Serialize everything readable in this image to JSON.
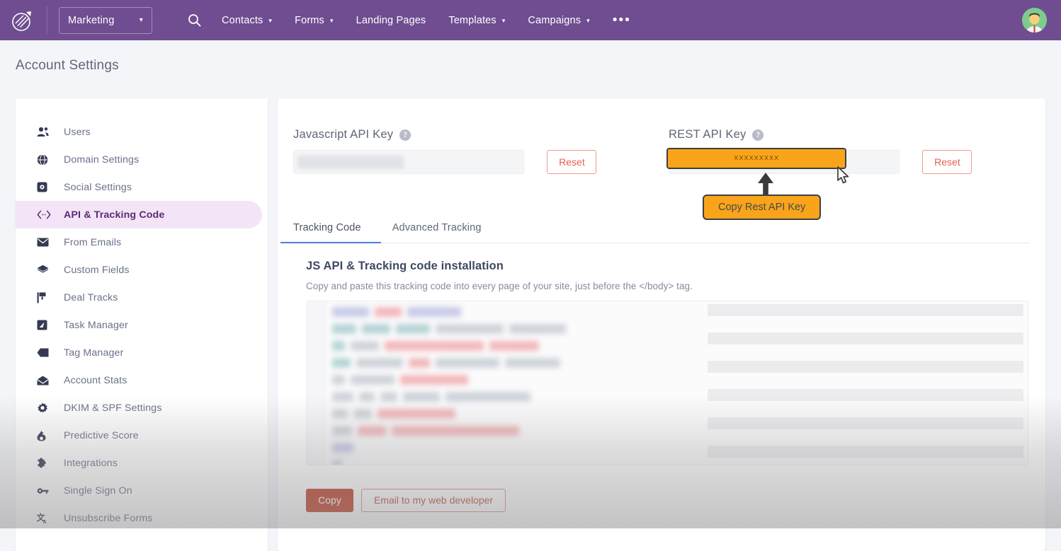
{
  "topnav": {
    "logo_icon": "agile-logo-icon",
    "org_selector": {
      "label": "Marketing",
      "caret": "▾"
    },
    "search_icon": "search-icon",
    "items": [
      {
        "label": "Contacts",
        "has_caret": true
      },
      {
        "label": "Forms",
        "has_caret": true
      },
      {
        "label": "Landing Pages",
        "has_caret": false
      },
      {
        "label": "Templates",
        "has_caret": true
      },
      {
        "label": "Campaigns",
        "has_caret": true
      }
    ],
    "more_label": "•••",
    "avatar_icon": "user-avatar-icon",
    "background_color": "#6f4d90"
  },
  "page": {
    "title": "Account Settings",
    "background_color": "#f4f5f9"
  },
  "sidebar": {
    "items": [
      {
        "label": "Users",
        "icon": "users-icon",
        "active": false
      },
      {
        "label": "Domain Settings",
        "icon": "globe-icon",
        "active": false
      },
      {
        "label": "Social Settings",
        "icon": "social-share-icon",
        "active": false
      },
      {
        "label": "API & Tracking Code",
        "icon": "code-brackets-icon",
        "active": true
      },
      {
        "label": "From Emails",
        "icon": "envelope-icon",
        "active": false
      },
      {
        "label": "Custom Fields",
        "icon": "layers-icon",
        "active": false
      },
      {
        "label": "Deal Tracks",
        "icon": "flag-icon",
        "active": false
      },
      {
        "label": "Task Manager",
        "icon": "task-edit-icon",
        "active": false
      },
      {
        "label": "Tag Manager",
        "icon": "tag-icon",
        "active": false
      },
      {
        "label": "Account Stats",
        "icon": "open-envelope-icon",
        "active": false
      },
      {
        "label": "DKIM & SPF Settings",
        "icon": "gear-icon",
        "active": false
      },
      {
        "label": "Predictive Score",
        "icon": "flame-icon",
        "active": false
      },
      {
        "label": "Integrations",
        "icon": "puzzle-icon",
        "active": false
      },
      {
        "label": "Single Sign On",
        "icon": "key-icon",
        "active": false
      },
      {
        "label": "Unsubscribe Forms",
        "icon": "translate-icon",
        "active": false
      }
    ],
    "active_background": "#f3e5f7",
    "active_text_color": "#5b2b72"
  },
  "api_keys": {
    "javascript": {
      "label": "Javascript API Key",
      "help_icon": "help-circle-icon",
      "value": "",
      "value_redacted": true,
      "reset_label": "Reset"
    },
    "rest": {
      "label": "REST API Key",
      "help_icon": "help-circle-icon",
      "value": "xxxxxxxxx",
      "value_masked": true,
      "reset_label": "Reset",
      "highlight_color": "#f9a41a",
      "highlight_border_color": "#3f3f3f"
    }
  },
  "annotation": {
    "tooltip_text": "Copy Rest API Key",
    "arrow_icon": "up-arrow-icon",
    "cursor_icon": "mouse-pointer-icon",
    "background_color": "#f9a41a"
  },
  "tabs": [
    {
      "label": "Tracking Code",
      "active": true
    },
    {
      "label": "Advanced Tracking",
      "active": false
    }
  ],
  "tracking_section": {
    "title": "JS API & Tracking code installation",
    "description": "Copy and paste this tracking code into every page of your site, just before the </body> tag.",
    "code_redacted": true,
    "buttons": {
      "copy": "Copy",
      "email": "Email to my web developer"
    }
  },
  "colors": {
    "nav_purple": "#6f4d90",
    "accent_orange": "#f9a41a",
    "tab_underline_blue": "#4a7fe0",
    "copy_button_red": "#c0412a",
    "reset_link_red": "#e8604c"
  }
}
